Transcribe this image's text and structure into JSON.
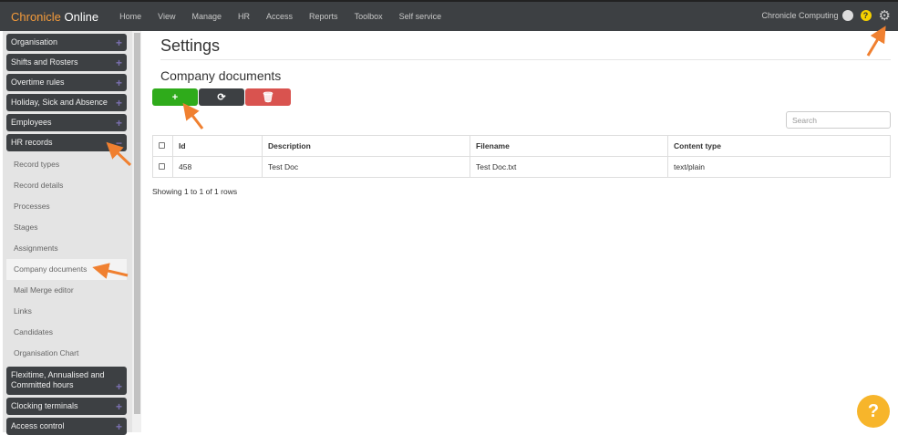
{
  "brand": {
    "part1": "Chronicle",
    "part2": " Online"
  },
  "nav": [
    "Home",
    "View",
    "Manage",
    "HR",
    "Access",
    "Reports",
    "Toolbox",
    "Self service"
  ],
  "user": {
    "name": "Chronicle Computing",
    "help": "?"
  },
  "sidebar": {
    "sections_top": [
      {
        "label": "Organisation",
        "sign": "+"
      },
      {
        "label": "Shifts and Rosters",
        "sign": "+"
      },
      {
        "label": "Overtime rules",
        "sign": "+"
      },
      {
        "label": "Holiday, Sick and Absence",
        "sign": "+"
      },
      {
        "label": "Employees",
        "sign": "+"
      },
      {
        "label": "HR records",
        "sign": "−"
      }
    ],
    "sub": [
      "Record types",
      "Record details",
      "Processes",
      "Stages",
      "Assignments",
      "Company documents",
      "Mail Merge editor",
      "Links",
      "Candidates",
      "Organisation Chart"
    ],
    "sections_bottom": [
      {
        "label": "Flexitime, Annualised and Committed hours",
        "sign": "+"
      },
      {
        "label": "Clocking terminals",
        "sign": "+"
      },
      {
        "label": "Access control",
        "sign": "+"
      }
    ]
  },
  "page": {
    "title": "Settings",
    "subtitle": "Company documents",
    "search_placeholder": "Search",
    "info": "Showing 1 to 1 of 1 rows"
  },
  "table": {
    "headers": [
      "Id",
      "Description",
      "Filename",
      "Content type"
    ],
    "rows": [
      [
        "458",
        "Test Doc",
        "Test Doc.txt",
        "text/plain"
      ]
    ]
  },
  "fab": "?",
  "colors": {
    "accent": "#f39a3b",
    "add": "#2fab1b",
    "delete": "#d9534f",
    "arrow": "#f08030"
  }
}
